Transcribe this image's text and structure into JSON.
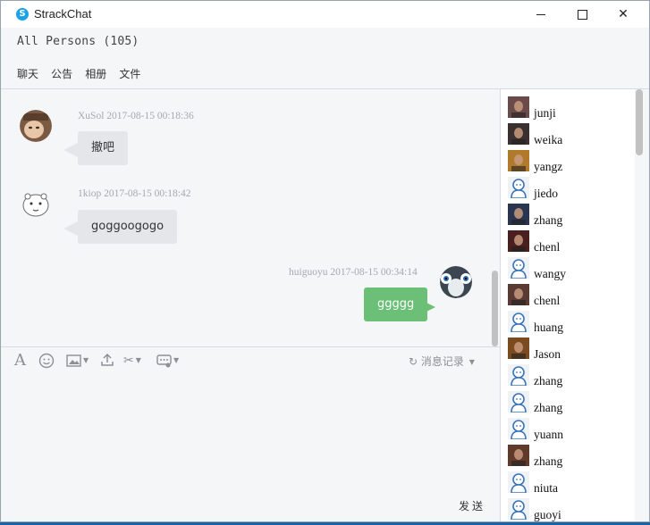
{
  "window": {
    "title": "StrackChat",
    "app_icon_letter": "S"
  },
  "header": {
    "room_title": "All Persons (105)",
    "tabs": [
      {
        "label": "聊天"
      },
      {
        "label": "公告"
      },
      {
        "label": "相册"
      },
      {
        "label": "文件"
      }
    ]
  },
  "messages": [
    {
      "sender": "XuSol",
      "time": "2017-08-15 00:18:36",
      "text": "撤吧",
      "side": "left",
      "avatar": "photo-child"
    },
    {
      "sender": "1kiop",
      "time": "2017-08-15 00:18:42",
      "text": "goggoogogo",
      "side": "left",
      "avatar": "hamster-sketch"
    },
    {
      "sender": "huiguoyu",
      "time": "2017-08-15 00:34:14",
      "text": "ggggg",
      "side": "right",
      "avatar": "penguin-face"
    }
  ],
  "toolbar": {
    "history_label": "消息记录",
    "send_label": "发送"
  },
  "users": [
    {
      "name": "junji",
      "avatar": "photo"
    },
    {
      "name": "weika",
      "avatar": "photo"
    },
    {
      "name": "yangz",
      "avatar": "photo"
    },
    {
      "name": "jiedo",
      "avatar": "default"
    },
    {
      "name": "zhang",
      "avatar": "photo"
    },
    {
      "name": "chenl",
      "avatar": "photo"
    },
    {
      "name": "wangy",
      "avatar": "default"
    },
    {
      "name": "chenl",
      "avatar": "photo"
    },
    {
      "name": "huang",
      "avatar": "default"
    },
    {
      "name": "Jason",
      "avatar": "photo"
    },
    {
      "name": "zhang",
      "avatar": "default"
    },
    {
      "name": "zhang",
      "avatar": "default"
    },
    {
      "name": "yuann",
      "avatar": "default"
    },
    {
      "name": "zhang",
      "avatar": "photo"
    },
    {
      "name": "niuta",
      "avatar": "default"
    },
    {
      "name": "guoyi",
      "avatar": "default"
    }
  ],
  "colors": {
    "bubble_left": "#e4e6e9",
    "bubble_right": "#6bbf76",
    "app_icon": "#1aa1e6",
    "desktop": "#1565a8"
  }
}
